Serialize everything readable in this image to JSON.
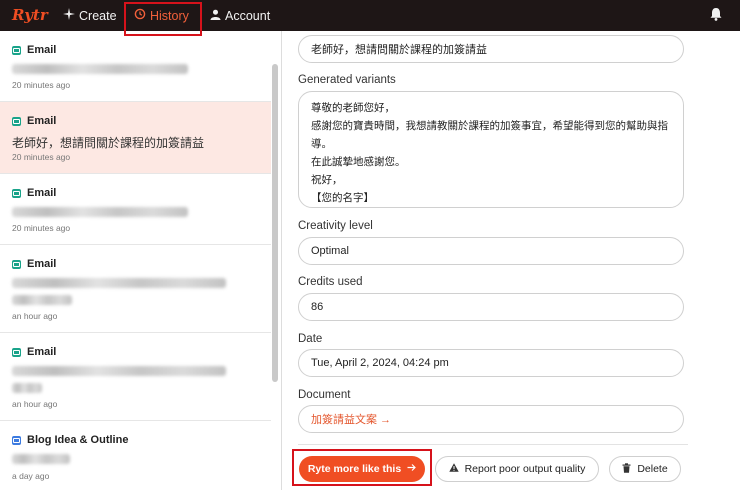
{
  "nav": {
    "logo": "Rytr",
    "create_label": "Create",
    "history_label": "History",
    "account_label": "Account",
    "accent_color": "#f04e23"
  },
  "sidebar": {
    "items": [
      {
        "type": "Email",
        "preview": "",
        "time": "20 minutes ago",
        "icon": "email-icon",
        "active": false
      },
      {
        "type": "Email",
        "preview": "老師好，想請問關於課程的加簽請益",
        "time": "20 minutes ago",
        "icon": "email-icon",
        "active": true
      },
      {
        "type": "Email",
        "preview": "",
        "time": "20 minutes ago",
        "icon": "email-icon",
        "active": false
      },
      {
        "type": "Email",
        "preview": "",
        "time": "an hour ago",
        "icon": "email-icon",
        "active": false
      },
      {
        "type": "Email",
        "preview": "",
        "time": "an hour ago",
        "icon": "email-icon",
        "active": false
      },
      {
        "type": "Blog Idea & Outline",
        "preview": "",
        "time": "a day ago",
        "icon": "blog-icon",
        "active": false
      }
    ]
  },
  "detail": {
    "subject_value": "老師好，想請問關於課程的加簽請益",
    "variants_label": "Generated variants",
    "variants_lines": [
      "尊敬的老師您好，",
      "感謝您的寶貴時間，我想請教關於課程的加簽事宜，希望能得到您的幫助與指導。",
      "在此誠摯地感謝您。",
      "祝好，",
      "【您的名字】"
    ],
    "creativity_label": "Creativity level",
    "creativity_value": "Optimal",
    "credits_label": "Credits used",
    "credits_value": "86",
    "date_label": "Date",
    "date_value": "Tue, April 2, 2024, 04:24 pm",
    "document_label": "Document",
    "document_value": "加簽請益文案 →"
  },
  "actions": {
    "ryte_more_label": "Ryte more like this",
    "report_label": "Report poor output quality",
    "delete_label": "Delete"
  }
}
